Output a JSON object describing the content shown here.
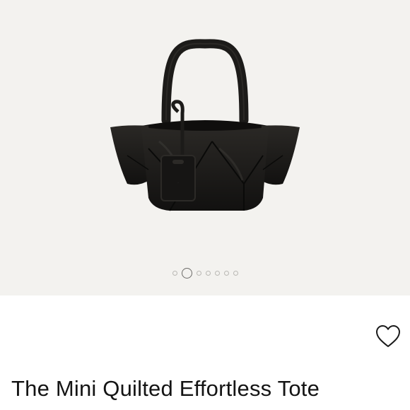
{
  "product": {
    "title": "The Mini Quilted Effortless Tote",
    "image_alt": "Black quilted leather mini tote bag with tag",
    "gallery": {
      "slide_count": 7,
      "active_index": 1
    }
  },
  "icons": {
    "wishlist": "heart-outline-icon"
  },
  "colors": {
    "gallery_background": "#f3f2ef",
    "bag": "#1c1b19",
    "text": "#141414"
  }
}
